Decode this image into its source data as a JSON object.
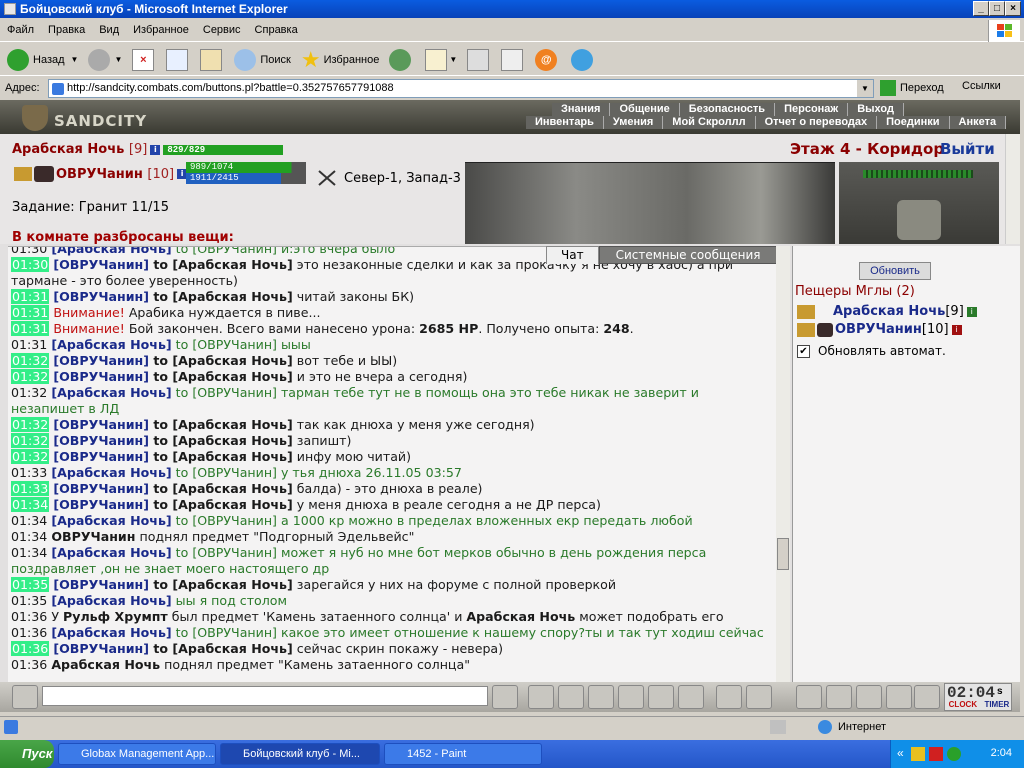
{
  "window": {
    "title": "Бойцовский клуб - Microsoft Internet Explorer"
  },
  "menu": [
    "Файл",
    "Правка",
    "Вид",
    "Избранное",
    "Сервис",
    "Справка"
  ],
  "toolbar": {
    "back": "Назад",
    "search": "Поиск",
    "favorites": "Избранное"
  },
  "address": {
    "label": "Адрес:",
    "url": "http://sandcity.combats.com/buttons.pl?battle=0.352757657791088",
    "go": "Переход",
    "links": "Ссылки"
  },
  "site": {
    "logo": "SANDCITY",
    "nav_top": [
      "Знания",
      "Общение",
      "Безопасность",
      "Персонаж",
      "Выход"
    ],
    "nav_bottom": [
      "Инвентарь",
      "Умения",
      "Мой Скроллл",
      "Отчет о переводах",
      "Поединки",
      "Анкета"
    ]
  },
  "player1": {
    "name": "Арабская Ночь",
    "level": "[9]",
    "hp": "829/829"
  },
  "player2": {
    "name": "ОВРУЧанин",
    "level": "[10]",
    "hp": "989/1074",
    "mana": "1911/2415"
  },
  "battle": {
    "location": "Север-1, Запад-3"
  },
  "task": "Задание: Гранит 11/15",
  "items_line": "В комнате разбросаны вещи:",
  "location": {
    "title": "Этаж 4 - Коридор",
    "exit": "Выйти"
  },
  "tabs": {
    "chat": "Чат",
    "system": "Системные сообщения"
  },
  "chat": [
    {
      "t": "01:30",
      "hl": false,
      "parts": [
        [
          "nm",
          "[Арабская Ночь]"
        ],
        [
          "g",
          " to [ОВРУЧанин] и:это вчера было"
        ]
      ]
    },
    {
      "t": "01:30",
      "hl": true,
      "parts": [
        [
          "nm",
          "[ОВРУЧанин]"
        ],
        [
          "b",
          " to [Арабская Ночь]"
        ],
        [
          "n",
          " это незаконные сделки и как за прокачку я не хочу в хаос) а при тармане - это более уверенность)"
        ]
      ]
    },
    {
      "t": "01:31",
      "hl": true,
      "parts": [
        [
          "nm",
          "[ОВРУЧанин]"
        ],
        [
          "b",
          " to [Арабская Ночь]"
        ],
        [
          "n",
          " читай законы БК)"
        ]
      ]
    },
    {
      "t": "01:31",
      "hl": true,
      "parts": [
        [
          "r",
          "Внимание!"
        ],
        [
          "n",
          " Арабика нуждается в пиве..."
        ]
      ]
    },
    {
      "t": "01:31",
      "hl": true,
      "parts": [
        [
          "r",
          "Внимание!"
        ],
        [
          "n",
          " Бой закончен. Всего вами нанесено урона: "
        ],
        [
          "b",
          "2685 HP"
        ],
        [
          "n",
          ". Получено опыта: "
        ],
        [
          "b",
          "248"
        ],
        [
          "n",
          "."
        ]
      ]
    },
    {
      "t": "01:31",
      "hl": false,
      "parts": [
        [
          "nm",
          "[Арабская Ночь]"
        ],
        [
          "g",
          " to [ОВРУЧанин] ыыы"
        ]
      ]
    },
    {
      "t": "01:32",
      "hl": true,
      "parts": [
        [
          "nm",
          "[ОВРУЧанин]"
        ],
        [
          "b",
          " to [Арабская Ночь]"
        ],
        [
          "n",
          " вот тебе и ЫЫ)"
        ]
      ]
    },
    {
      "t": "01:32",
      "hl": true,
      "parts": [
        [
          "nm",
          "[ОВРУЧанин]"
        ],
        [
          "b",
          " to [Арабская Ночь]"
        ],
        [
          "n",
          " и это не вчера а сегодня)"
        ]
      ]
    },
    {
      "t": "01:32",
      "hl": false,
      "parts": [
        [
          "nm",
          "[Арабская Ночь]"
        ],
        [
          "g",
          " to [ОВРУЧанин] тарман тебе тут не в помощь она это тебе никак не заверит и незапишет в ЛД"
        ]
      ]
    },
    {
      "t": "01:32",
      "hl": true,
      "parts": [
        [
          "nm",
          "[ОВРУЧанин]"
        ],
        [
          "b",
          " to [Арабская Ночь]"
        ],
        [
          "n",
          " так как днюха у меня уже сегодня)"
        ]
      ]
    },
    {
      "t": "01:32",
      "hl": true,
      "parts": [
        [
          "nm",
          "[ОВРУЧанин]"
        ],
        [
          "b",
          " to [Арабская Ночь]"
        ],
        [
          "n",
          " запишт)"
        ]
      ]
    },
    {
      "t": "01:32",
      "hl": true,
      "parts": [
        [
          "nm",
          "[ОВРУЧанин]"
        ],
        [
          "b",
          " to [Арабская Ночь]"
        ],
        [
          "n",
          " инфу мою читай)"
        ]
      ]
    },
    {
      "t": "01:33",
      "hl": false,
      "parts": [
        [
          "nm",
          "[Арабская Ночь]"
        ],
        [
          "g",
          " to [ОВРУЧанин] у тья днюха 26.11.05 03:57"
        ]
      ]
    },
    {
      "t": "01:33",
      "hl": true,
      "parts": [
        [
          "nm",
          "[ОВРУЧанин]"
        ],
        [
          "b",
          " to [Арабская Ночь]"
        ],
        [
          "n",
          " балда) - это днюха в реале)"
        ]
      ]
    },
    {
      "t": "01:34",
      "hl": true,
      "parts": [
        [
          "nm",
          "[ОВРУЧанин]"
        ],
        [
          "b",
          " to [Арабская Ночь]"
        ],
        [
          "n",
          " у меня днюха в реале сегодня а не ДР перса)"
        ]
      ]
    },
    {
      "t": "01:34",
      "hl": false,
      "parts": [
        [
          "nm",
          "[Арабская Ночь]"
        ],
        [
          "g",
          " to [ОВРУЧанин] а 1000 кр можно в пределах вложенных екр передать любой"
        ]
      ]
    },
    {
      "t": "01:34",
      "hl": false,
      "parts": [
        [
          "b",
          "ОВРУЧанин"
        ],
        [
          "n",
          " поднял предмет \"Подгорный Эдельвейс\""
        ]
      ]
    },
    {
      "t": "01:34",
      "hl": false,
      "parts": [
        [
          "nm",
          "[Арабская Ночь]"
        ],
        [
          "g",
          " to [ОВРУЧанин] может я нуб но мне бот мерков обычно в день рождения перса поздравляет ,он не знает моего настоящего др"
        ]
      ]
    },
    {
      "t": "01:35",
      "hl": true,
      "parts": [
        [
          "nm",
          "[ОВРУЧанин]"
        ],
        [
          "b",
          " to [Арабская Ночь]"
        ],
        [
          "n",
          " зарегайся у них на форуме с полной проверкой"
        ]
      ]
    },
    {
      "t": "01:35",
      "hl": false,
      "parts": [
        [
          "nm",
          "[Арабская Ночь]"
        ],
        [
          "g",
          " ыы я под столом"
        ]
      ]
    },
    {
      "t": "01:36",
      "hl": false,
      "parts": [
        [
          "n",
          "У "
        ],
        [
          "b",
          "Рульф Хрумпт"
        ],
        [
          "n",
          " был предмет 'Камень затаенного солнца' и "
        ],
        [
          "b",
          "Арабская Ночь"
        ],
        [
          "n",
          " может подобрать его"
        ]
      ]
    },
    {
      "t": "01:36",
      "hl": false,
      "parts": [
        [
          "nm",
          "[Арабская Ночь]"
        ],
        [
          "g",
          " to [ОВРУЧанин] какое это имеет отношение к нашему спору?ты и так тут ходиш сейчас"
        ]
      ]
    },
    {
      "t": "01:36",
      "hl": true,
      "parts": [
        [
          "nm",
          "[ОВРУЧанин]"
        ],
        [
          "b",
          " to [Арабская Ночь]"
        ],
        [
          "n",
          " сейчас скрин покажу - невера)"
        ]
      ]
    },
    {
      "t": "01:36",
      "hl": false,
      "parts": [
        [
          "b",
          "Арабская Ночь"
        ],
        [
          "n",
          " поднял предмет \"Камень затаенного солнца\""
        ]
      ]
    }
  ],
  "room": {
    "refresh": "Обновить",
    "title": "Пещеры Мглы (2)",
    "players": [
      {
        "name": "Арабская Ночь",
        "level": "[9]"
      },
      {
        "name": "ОВРУЧанин",
        "level": "[10]"
      }
    ],
    "auto_update": "Обновлять автомат."
  },
  "bottom": {
    "clock": "02:04",
    "clock_sec": "s",
    "clock_label": "CLOCK",
    "timer_label": "TIMER"
  },
  "status": {
    "zone": "Интернет"
  },
  "taskbar": {
    "start": "Пуск",
    "tasks": [
      "Globax Management App...",
      "Бойцовский клуб - Mi...",
      "1452 - Paint"
    ],
    "time": "2:04"
  },
  "colors": {
    "hl": "#33ee88",
    "green": "#2a7a2a",
    "navy": "#1a2a8a",
    "dark_red": "#8b0000"
  }
}
